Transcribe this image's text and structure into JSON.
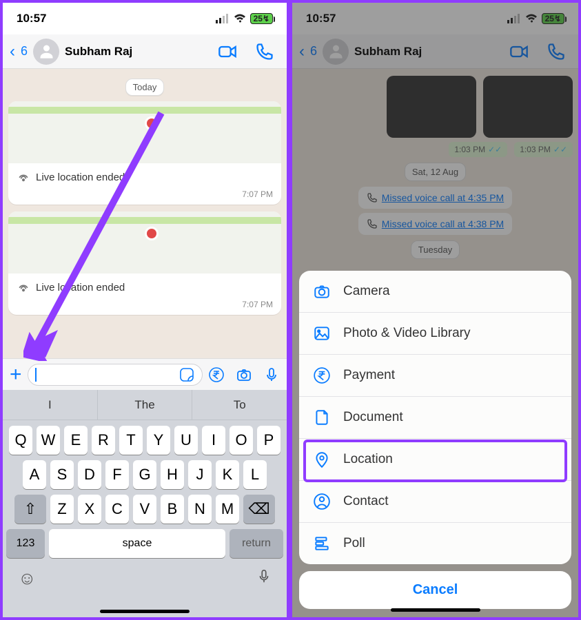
{
  "status": {
    "time": "10:57",
    "battery": "25"
  },
  "header": {
    "back_count": "6",
    "contact": "Subham Raj"
  },
  "left": {
    "date": "Today",
    "loc_label": "Live location ended",
    "time": "7:07 PM",
    "suggestions": [
      "I",
      "The",
      "To"
    ],
    "keys_r1": [
      "Q",
      "W",
      "E",
      "R",
      "T",
      "Y",
      "U",
      "I",
      "O",
      "P"
    ],
    "keys_r2": [
      "A",
      "S",
      "D",
      "F",
      "G",
      "H",
      "J",
      "K",
      "L"
    ],
    "keys_r3": [
      "Z",
      "X",
      "C",
      "V",
      "B",
      "N",
      "M"
    ],
    "num": "123",
    "space": "space",
    "return": "return"
  },
  "right": {
    "ts1": "1:03 PM",
    "ts2": "1:03 PM",
    "date1": "Sat, 12 Aug",
    "missed1": "Missed voice call at 4:35 PM",
    "missed2": "Missed voice call at 4:38 PM",
    "date2": "Tuesday",
    "items": [
      "Camera",
      "Photo & Video Library",
      "Payment",
      "Document",
      "Location",
      "Contact",
      "Poll"
    ],
    "cancel": "Cancel"
  }
}
